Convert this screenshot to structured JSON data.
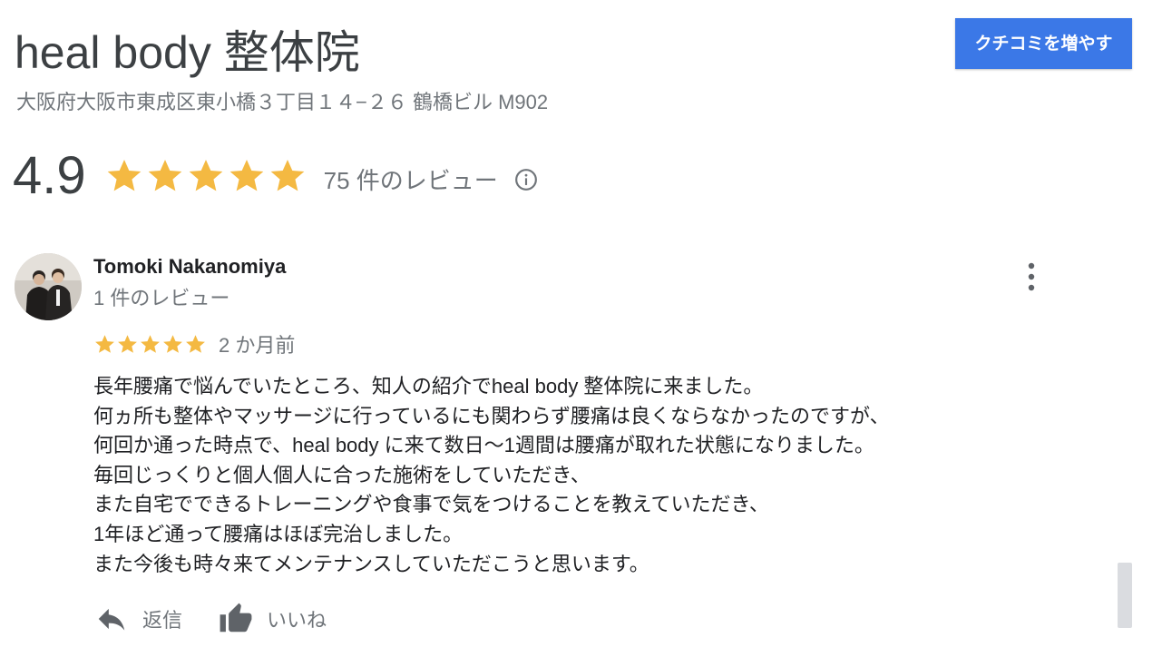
{
  "business": {
    "name": "heal body 整体院",
    "address": "大阪府大阪市東成区東小橋３丁目１４−２６ 鶴橋ビル M902"
  },
  "header": {
    "add_review_label": "クチコミを増やす"
  },
  "summary": {
    "rating": "4.9",
    "star_score": 5,
    "review_count_text": "75 件のレビュー",
    "info_icon": "info-icon"
  },
  "review": {
    "reviewer_name": "Tomoki Nakanomiya",
    "reviewer_meta": "1 件のレビュー",
    "star_score": 5,
    "date": "2 か月前",
    "text_lines": [
      "長年腰痛で悩んでいたところ、知人の紹介でheal body 整体院に来ました。",
      "何ヵ所も整体やマッサージに行っているにも関わらず腰痛は良くならなかったのですが、",
      "何回か通った時点で、heal body に来て数日〜1週間は腰痛が取れた状態になりました。",
      "毎回じっくりと個人個人に合った施術をしていただき、",
      "また自宅でできるトレーニングや食事で気をつけることを教えていただき、",
      "1年ほど通って腰痛はほぼ完治しました。",
      "また今後も時々来てメンテナンスしていただこうと思います。"
    ],
    "more_icon": "more-vert-icon",
    "actions": {
      "reply_label": "返信",
      "like_label": "いいね"
    }
  },
  "colors": {
    "accent": "#3b78e7",
    "star": "#f4b942",
    "text_primary": "#202124",
    "text_secondary": "#70757a"
  }
}
